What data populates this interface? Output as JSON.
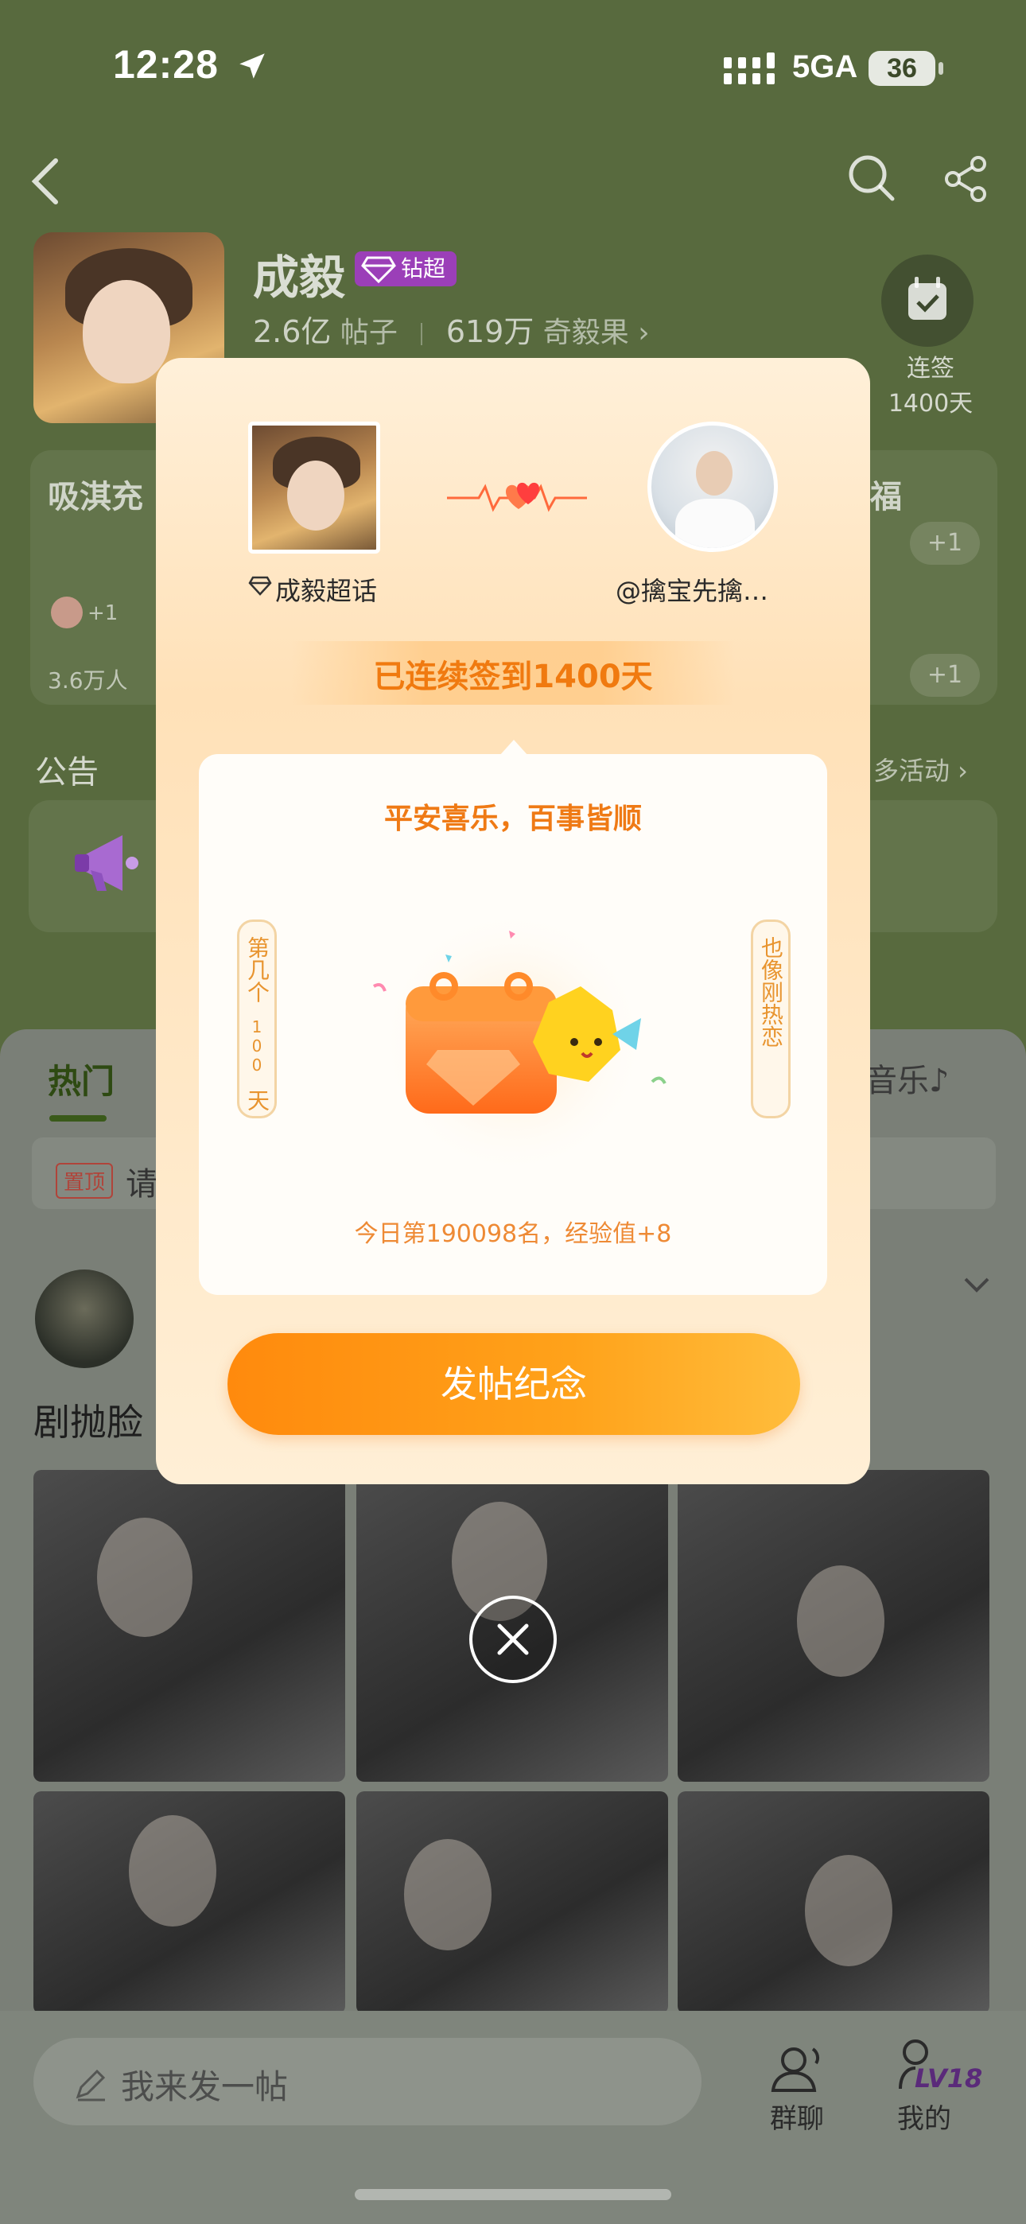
{
  "status_bar": {
    "time": "12:28",
    "network": "5GA",
    "battery": "36"
  },
  "profile": {
    "name": "成毅",
    "badge": "钻超",
    "posts_count": "2.6亿",
    "posts_label": "帖子",
    "fans_count": "619万",
    "fans_label": "奇毅果",
    "fans_chevron": "›",
    "checkin_label_1": "连签",
    "checkin_label_2": "1400天"
  },
  "cards": {
    "left_title": "吸淇充",
    "left_plus": "+1",
    "left_people": "3.6万人",
    "right_title": "福",
    "right_plus_1": "+1",
    "right_plus_2": "+1"
  },
  "announcement": {
    "label": "公告",
    "more": "多活动 ›"
  },
  "tabs": {
    "hot": "热门",
    "music": "音乐♪"
  },
  "pinned": {
    "tag": "置顶",
    "text": "请"
  },
  "post": {
    "title": "剧抛脸"
  },
  "bottom_bar": {
    "post_placeholder": "我来发一帖",
    "group_chat": "群聊",
    "mine": "我的",
    "level": "LV18"
  },
  "modal": {
    "left_name": "成毅超话",
    "right_name": "@擒宝先擒…",
    "streak": "已连续签到1400天",
    "blessing": "平安喜乐，百事皆顺",
    "scroll_left_1": "第几个",
    "scroll_left_2": "100",
    "scroll_left_3": "天",
    "scroll_right": "也像刚热恋",
    "rank": "今日第190098名，经验值+8",
    "cta": "发帖纪念"
  },
  "colors": {
    "accent_orange": "#ff8a0d",
    "badge_purple": "#9b3fb8",
    "header_green": "#586a3e"
  }
}
